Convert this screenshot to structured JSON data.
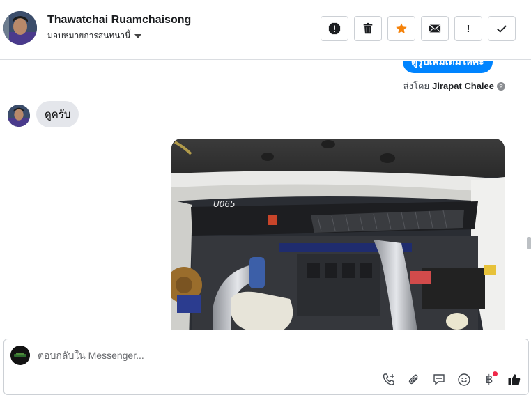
{
  "header": {
    "name": "Thawatchai Ruamchaisong",
    "assign_label": "มอบหมายการสนทนานี้",
    "actions": [
      {
        "icon": "alert-circle-icon",
        "label": ""
      },
      {
        "icon": "trash-icon",
        "label": ""
      },
      {
        "icon": "star-icon",
        "label": ""
      },
      {
        "icon": "mail-icon",
        "label": ""
      },
      {
        "icon": "exclamation-icon",
        "label": "!"
      },
      {
        "icon": "checkmark-icon",
        "label": ""
      }
    ],
    "star_color": "#f5820a"
  },
  "conversation": {
    "outgoing_partial": "ดูรูปเพิ่มเติมให้ค่ะ",
    "sent_by_prefix": "ส่งโดย",
    "sent_by_name": "Jirapat Chalee",
    "help_glyph": "?",
    "incoming_message": "ดูครับ",
    "photo_caption_marking": "U065"
  },
  "composer": {
    "placeholder": "ตอบกลับใน Messenger...",
    "tools": [
      "add-call-icon",
      "attachment-icon",
      "saved-reply-icon",
      "emoji-icon",
      "payment-baht-icon",
      "like-icon"
    ],
    "baht_glyph": "฿"
  },
  "colors": {
    "accent": "#0084ff",
    "incoming_bubble": "#e4e6eb",
    "notification_dot": "#f02849"
  }
}
